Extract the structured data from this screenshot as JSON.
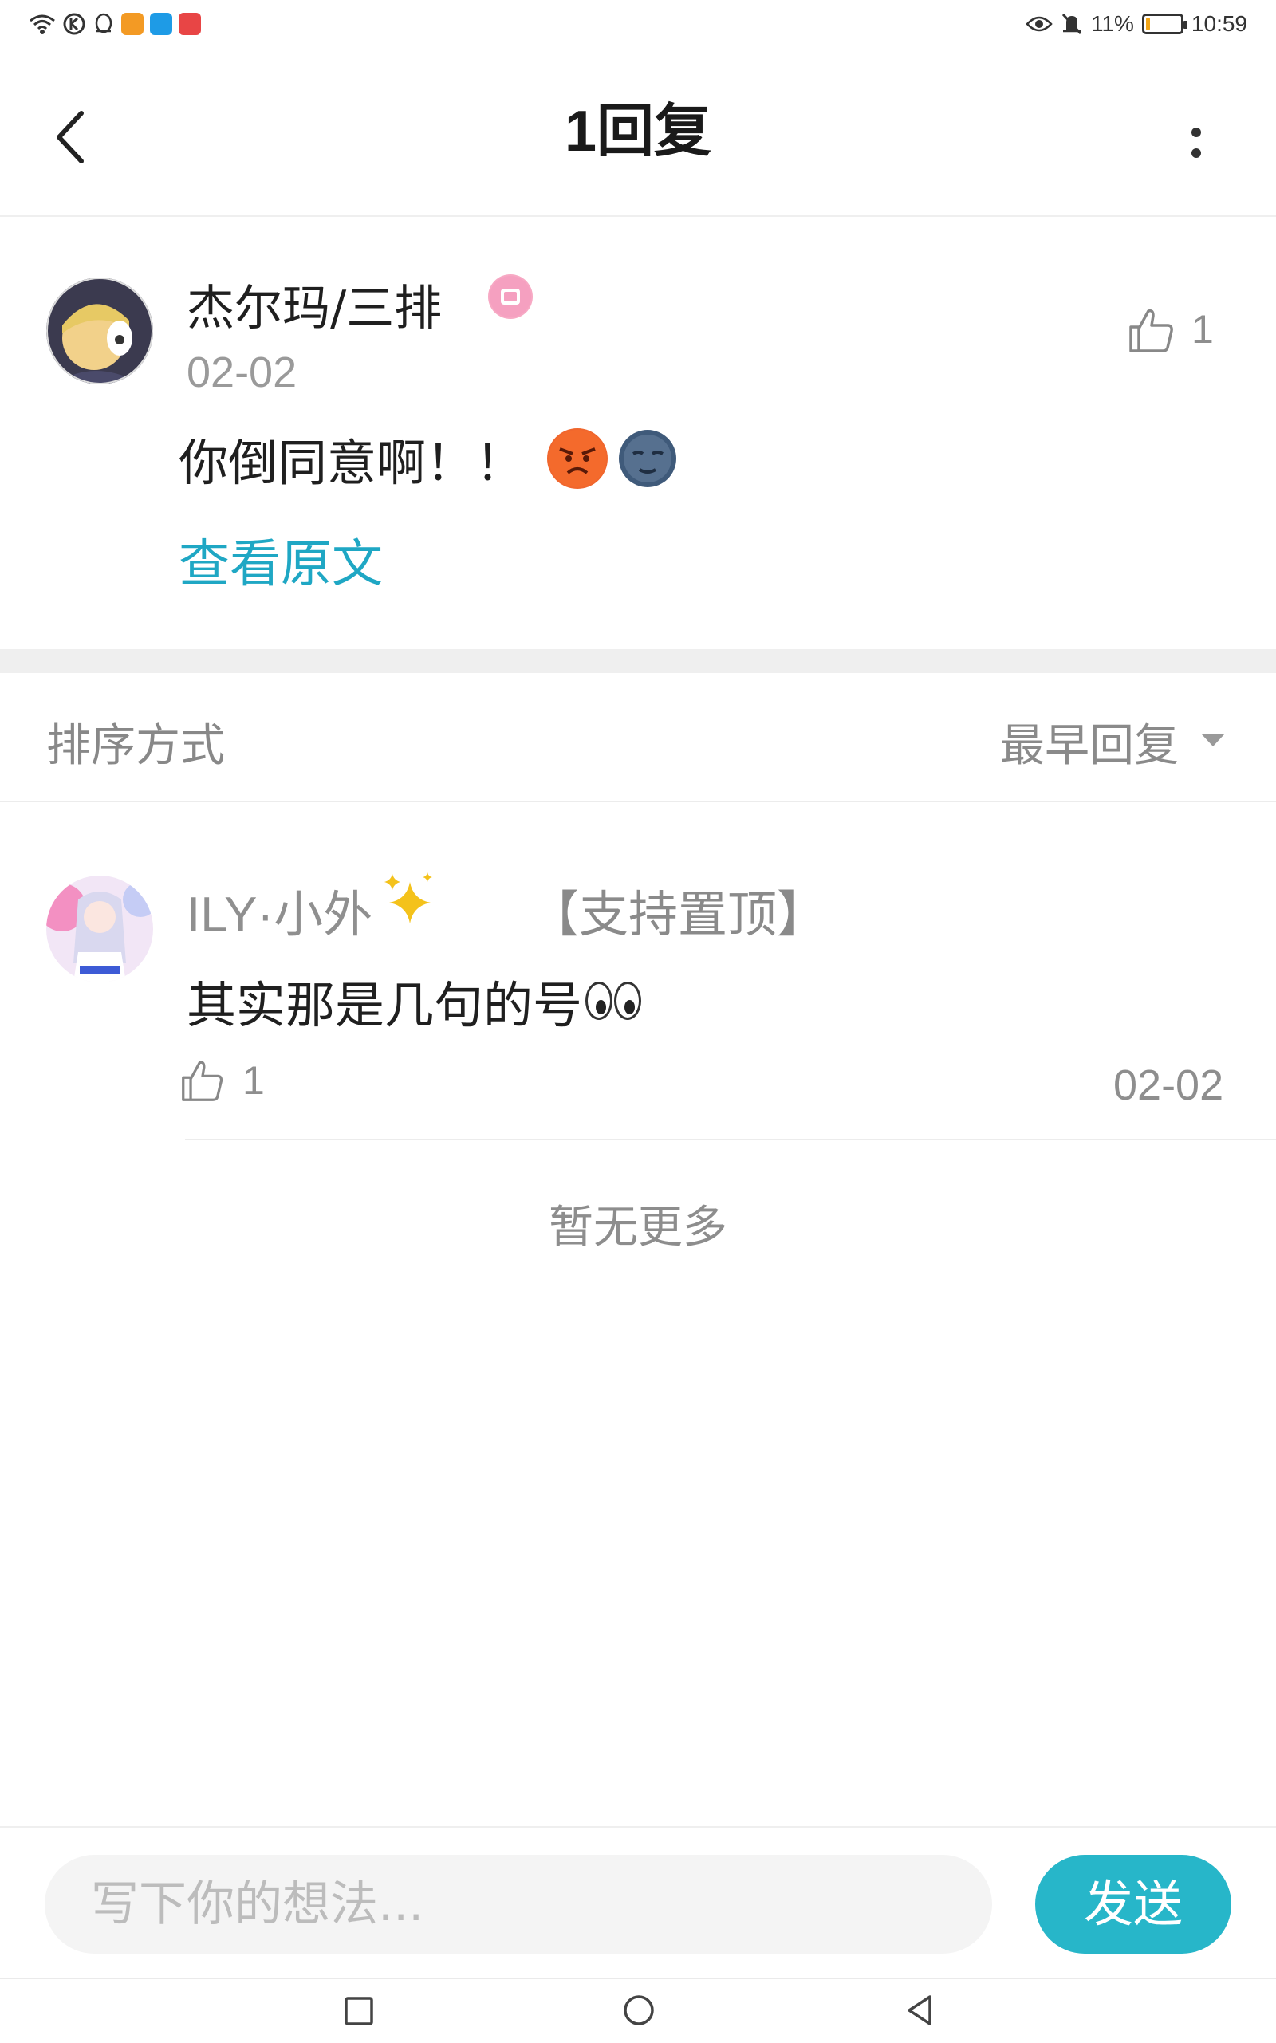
{
  "status_bar": {
    "battery_percent": "11%",
    "time": "10:59",
    "battery_level": 0.11
  },
  "header": {
    "title": "1回复"
  },
  "main_comment": {
    "author": "杰尔玛/三排",
    "date": "02-02",
    "likes": "1",
    "text": "你倒同意啊！！",
    "emojis": [
      "angry-face",
      "new-moon-face"
    ],
    "view_original": "查看原文"
  },
  "sort": {
    "label": "排序方式",
    "value": "最早回复"
  },
  "reply": {
    "author": "ILY·小外",
    "tag": "【支持置顶】",
    "text": "其实那是几句的号",
    "likes": "1",
    "date": "02-02"
  },
  "no_more": "暂无更多",
  "composer": {
    "placeholder": "写下你的想法...",
    "send_label": "发送"
  },
  "colors": {
    "accent": "#27b6c9",
    "link": "#1fa7c4",
    "battery": "#f2a516"
  }
}
